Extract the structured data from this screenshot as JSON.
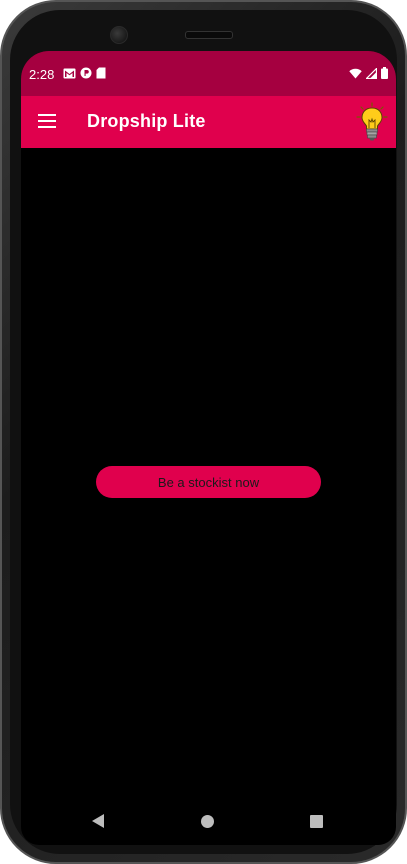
{
  "status_bar": {
    "time": "2:28",
    "left_icons": [
      "gmail-icon",
      "podcast-icon",
      "sd-card-icon"
    ],
    "right_icons": [
      "wifi-icon",
      "signal-icon",
      "battery-icon"
    ],
    "background": "#a50040"
  },
  "app_bar": {
    "title": "Dropship Lite",
    "menu_icon": "hamburger-menu-icon",
    "action_icon": "lightbulb-icon",
    "background": "#e0004d"
  },
  "main": {
    "background": "#000000",
    "cta_label": "Be a stockist now",
    "cta_color": "#e0004d"
  },
  "nav_bar": {
    "buttons": [
      "back-icon",
      "home-icon",
      "recents-icon"
    ]
  }
}
